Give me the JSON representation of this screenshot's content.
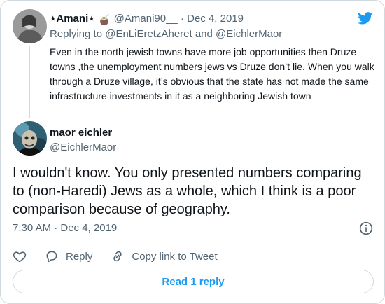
{
  "colors": {
    "accent": "#1d9bf0",
    "secondary_text": "#536471",
    "primary_text": "#0f1419",
    "border": "#cfd9de"
  },
  "parent_tweet": {
    "display_name": "⋆Amani⋆",
    "name_emoji": "🧉",
    "handle": "@Amani90__",
    "separator": "·",
    "date": "Dec 4, 2019",
    "replying_prefix": "Replying to",
    "reply_handle_1": "@EnLiEretzAheret",
    "reply_and": "and",
    "reply_handle_2": "@EichlerMaor",
    "text": "Even in the north jewish towns have more job opportunities then Druze towns ,the unemployment numbers jews vs Druze don’t lie. When you walk through a Druze village, it’s obvious that the state has not made the same infrastructure investments in it as a neighboring Jewish town"
  },
  "main_tweet": {
    "display_name": "maor eichler",
    "handle": "@EichlerMaor",
    "text": "I wouldn't know. You only presented numbers comparing to (non-Haredi) Jews as a whole, which I think is a poor comparison because of geography.",
    "timestamp": "7:30 AM · Dec 4, 2019"
  },
  "actions": {
    "like_icon": "heart-icon",
    "reply_label": "Reply",
    "copy_link_label": "Copy link to Tweet"
  },
  "read_replies_label": "Read 1 reply",
  "icons": [
    "twitter-bird-icon",
    "info-icon",
    "heart-icon",
    "reply-icon",
    "link-icon"
  ]
}
